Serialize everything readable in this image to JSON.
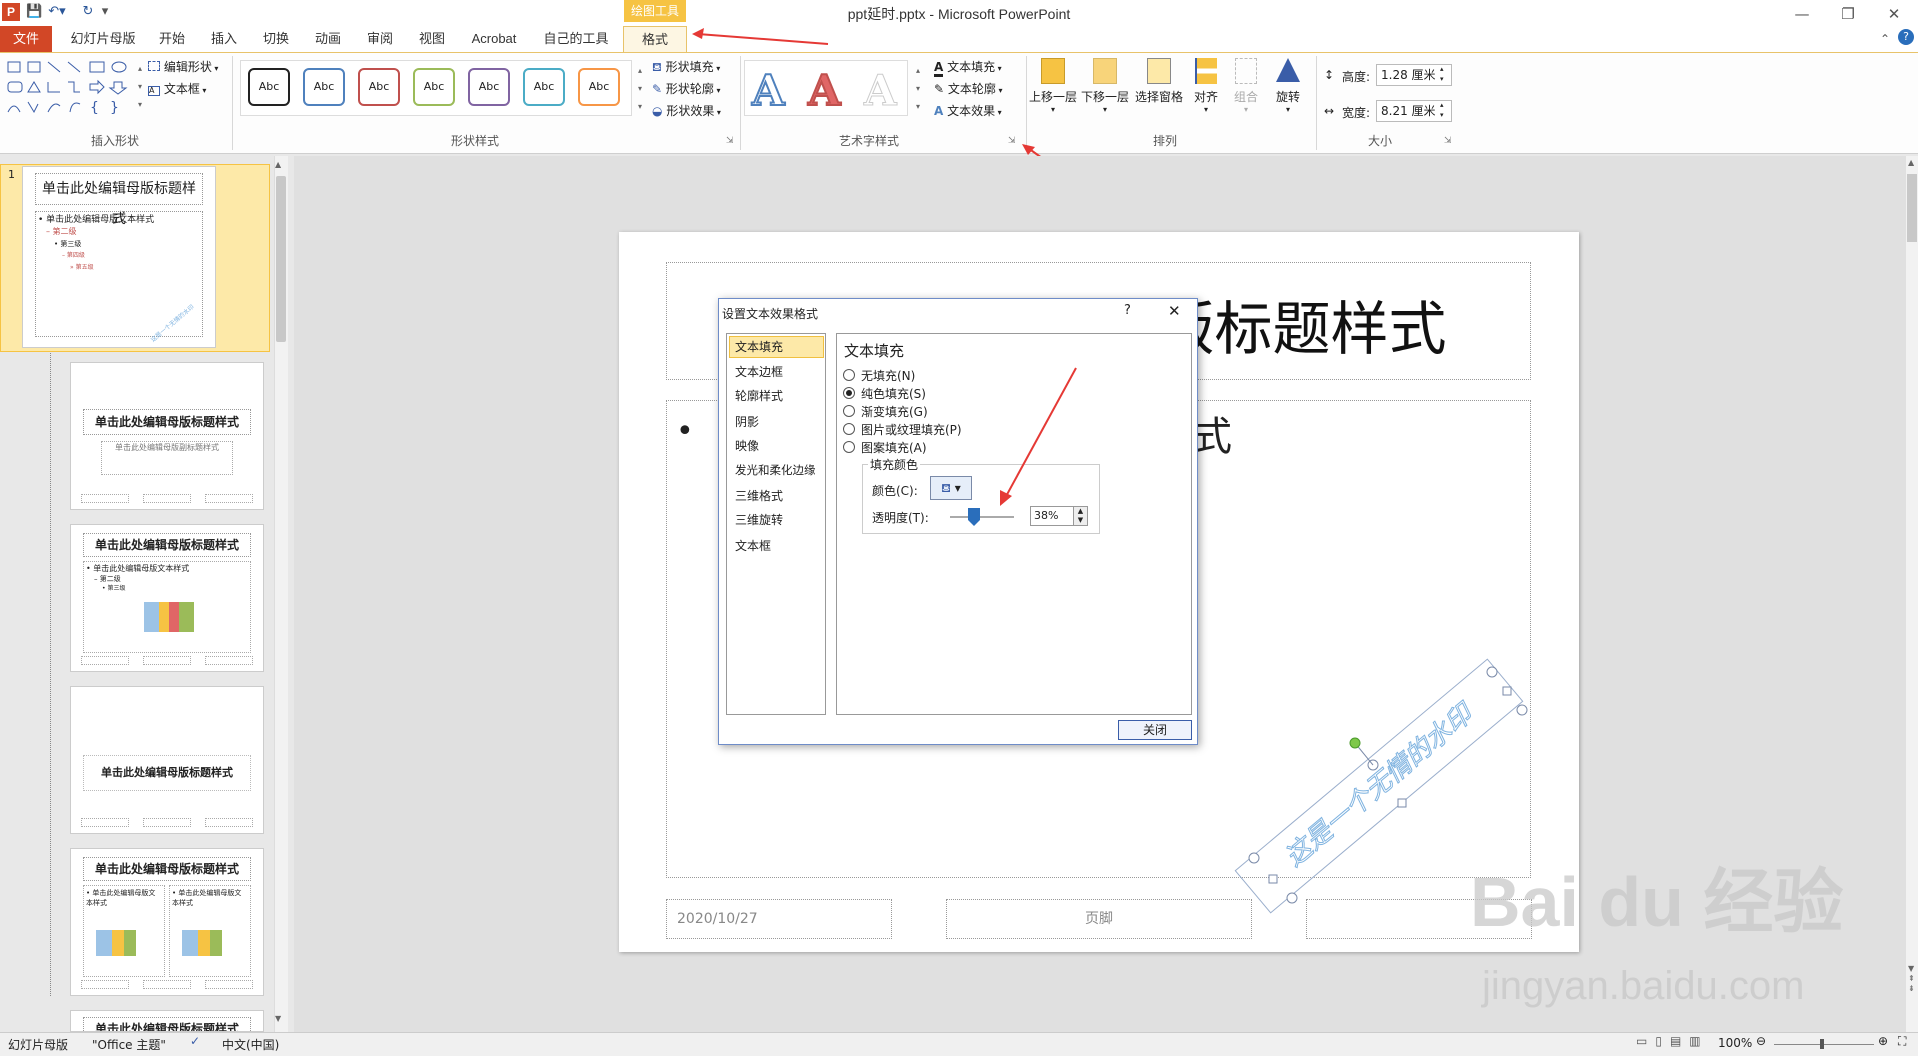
{
  "window": {
    "app_icon_label": "P",
    "title": "ppt延时.pptx - Microsoft PowerPoint",
    "context_tab_label": "绘图工具",
    "minimize": "—",
    "restore": "❐",
    "close": "✕"
  },
  "tabs": [
    "文件",
    "幻灯片母版",
    "开始",
    "插入",
    "切换",
    "动画",
    "审阅",
    "视图",
    "Acrobat",
    "自己的工具",
    "格式"
  ],
  "ribbon": {
    "groups": {
      "insert_shapes": "插入形状",
      "shape_styles": "形状样式",
      "wordart_styles": "艺术字样式",
      "arrange": "排列",
      "size": "大小"
    },
    "edit_shape": "编辑形状",
    "text_box": "文本框",
    "shape_fill": "形状填充",
    "shape_outline": "形状轮廓",
    "shape_effects": "形状效果",
    "abc_label": "Abc",
    "wordart_letter": "A",
    "text_fill": "文本填充",
    "text_outline": "文本轮廓",
    "text_effects": "文本效果",
    "bring_forward": "上移一层",
    "send_backward": "下移一层",
    "selection_pane": "选择窗格",
    "align": "对齐",
    "group": "组合",
    "rotate": "旋转",
    "height_label": "高度:",
    "height_value": "1.28 厘米",
    "width_label": "宽度:",
    "width_value": "8.21 厘米",
    "shape_colors": [
      "#222222",
      "#4f81bd",
      "#c0504d",
      "#9bbb59",
      "#8064a2",
      "#4bacc6",
      "#f79646"
    ]
  },
  "thumbnails": {
    "slide_number": "1",
    "master_title": "单击此处编辑母版标题样式",
    "master_text": "• 单击此处编辑母版文本样式",
    "level2": "– 第二级",
    "level3": "• 第三级",
    "level4": "– 第四级",
    "level5": "» 第五级",
    "layout_title": "单击此处编辑母版标题样式",
    "layout_subtitle": "单击此处编辑母版副标题样式",
    "watermark": "这是一个无情的水印"
  },
  "slide": {
    "title": "单击此处编辑母版标题样式",
    "body_fragment": "式",
    "bullet": "•",
    "date": "2020/10/27",
    "footer": "页脚",
    "watermark_text": "这是一个无情的水印"
  },
  "dialog": {
    "title": "设置文本效果格式",
    "help": "?",
    "close_x": "✕",
    "categories": [
      "文本填充",
      "文本边框",
      "轮廓样式",
      "阴影",
      "映像",
      "发光和柔化边缘",
      "三维格式",
      "三维旋转",
      "文本框"
    ],
    "panel_title": "文本填充",
    "options": [
      "无填充(N)",
      "纯色填充(S)",
      "渐变填充(G)",
      "图片或纹理填充(P)",
      "图案填充(A)"
    ],
    "selected_option": "纯色填充(S)",
    "fill_color_group": "填充颜色",
    "color_label": "颜色(C):",
    "transparency_label": "透明度(T):",
    "transparency_value": "38%",
    "transparency_percent": 38,
    "close_button": "关闭"
  },
  "statusbar": {
    "view": "幻灯片母版",
    "theme": "\"Office 主题\"",
    "language": "中文(中国)",
    "zoom": "100%"
  },
  "watermark_brand": {
    "logo": "Bai du 经验",
    "url": "jingyan.baidu.com"
  },
  "colors": {
    "accent": "#d24726",
    "context": "#f6c343",
    "arrow": "#e53935",
    "watermark_blue": "#7fb3e0"
  }
}
